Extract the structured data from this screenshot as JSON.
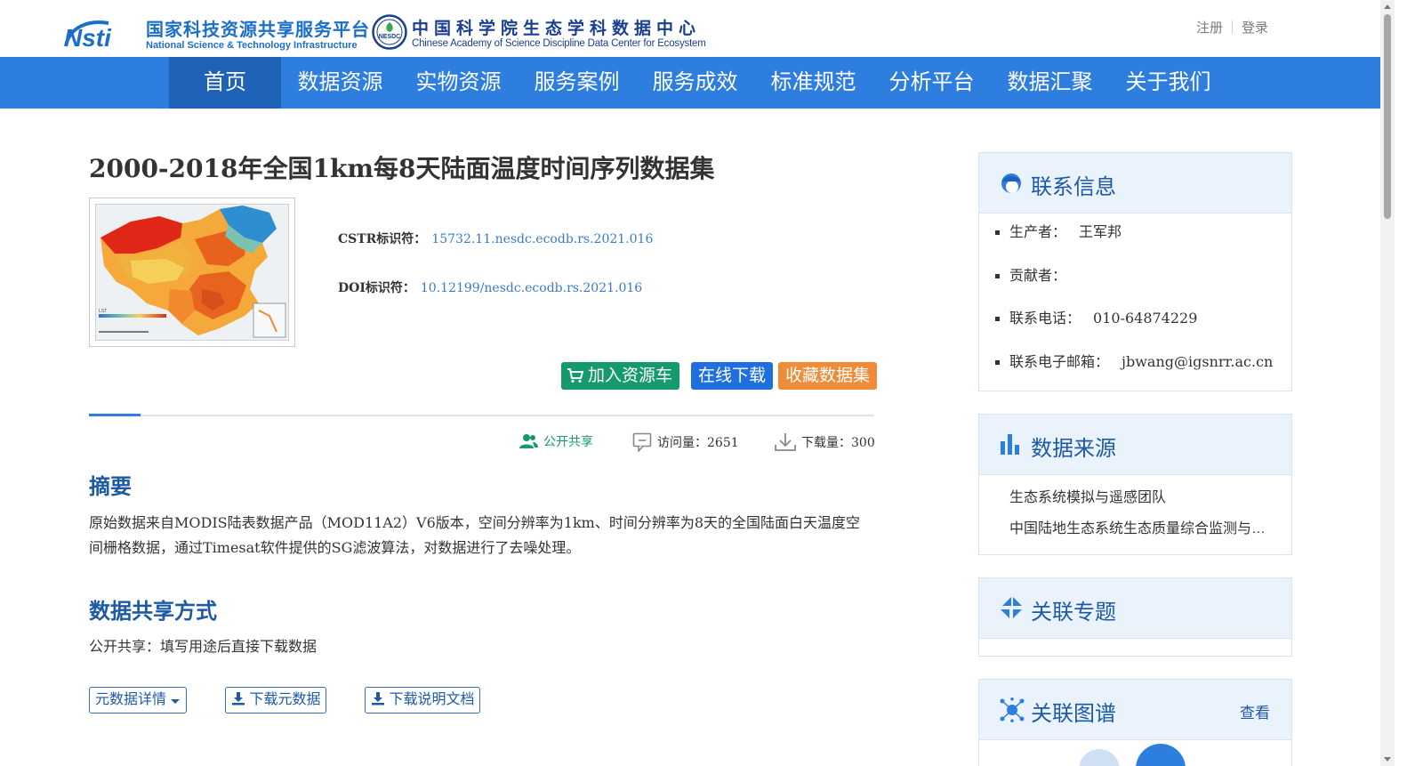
{
  "header": {
    "logo1_title": "国家科技资源共享服务平台",
    "logo1_subtitle": "National Science & Technology Infrastructure",
    "logo2_title": "中国科学院生态学科数据中心",
    "logo2_subtitle": "Chinese Academy of Science Discipline Data Center for Ecosystem",
    "logo2_badge": "NESDC",
    "register": "注册",
    "login": "登录"
  },
  "nav": [
    {
      "label": "首页",
      "active": true
    },
    {
      "label": "数据资源",
      "active": false
    },
    {
      "label": "实物资源",
      "active": false
    },
    {
      "label": "服务案例",
      "active": false
    },
    {
      "label": "服务成效",
      "active": false
    },
    {
      "label": "标准规范",
      "active": false
    },
    {
      "label": "分析平台",
      "active": false
    },
    {
      "label": "数据汇聚",
      "active": false
    },
    {
      "label": "关于我们",
      "active": false
    }
  ],
  "dataset": {
    "title": "2000-2018年全国1km每8天陆面温度时间序列数据集",
    "thumbnail_legend": "LST",
    "cstr_label": "CSTR标识符：",
    "cstr_value": "15732.11.nesdc.ecodb.rs.2021.016",
    "doi_label": "DOI标识符：",
    "doi_value": "10.12199/nesdc.ecodb.rs.2021.016"
  },
  "actions": {
    "add_cart": "加入资源车",
    "download_online": "在线下载",
    "favorite": "收藏数据集"
  },
  "stats": {
    "public_share": "公开共享",
    "visits": "访问量：2651",
    "downloads": "下载量：300"
  },
  "abstract": {
    "heading": "摘要",
    "text": "原始数据来自MODIS陆表数据产品（MOD11A2）V6版本，空间分辨率为1km、时间分辨率为8天的全国陆面白天温度空间栅格数据，通过Timesat软件提供的SG滤波算法，对数据进行了去噪处理。"
  },
  "share": {
    "heading": "数据共享方式",
    "text": "公开共享：填写用途后直接下载数据"
  },
  "buttons": {
    "metadata_details": "元数据详情",
    "download_metadata": "下载元数据",
    "download_doc": "下载说明文档"
  },
  "sidebar": {
    "contact": {
      "title": "联系信息",
      "items": [
        {
          "label": "生产者：",
          "value": "王军邦"
        },
        {
          "label": "贡献者：",
          "value": ""
        },
        {
          "label": "联系电话：",
          "value": "010-64874229"
        },
        {
          "label": "联系电子邮箱：",
          "value": "jbwang@igsnrr.ac.cn"
        }
      ]
    },
    "source": {
      "title": "数据来源",
      "items": [
        "生态系统模拟与遥感团队",
        "中国陆地生态系统生态质量综合监测与评估"
      ]
    },
    "topic": {
      "title": "关联专题"
    },
    "graph": {
      "title": "关联图谱",
      "link": "查看"
    }
  },
  "colors": {
    "nav_bg": "#2e7ee0",
    "nav_active": "#1f63b8",
    "heading_blue": "#1d5aa6",
    "green": "#159b6b",
    "orange": "#ef8c3a"
  }
}
